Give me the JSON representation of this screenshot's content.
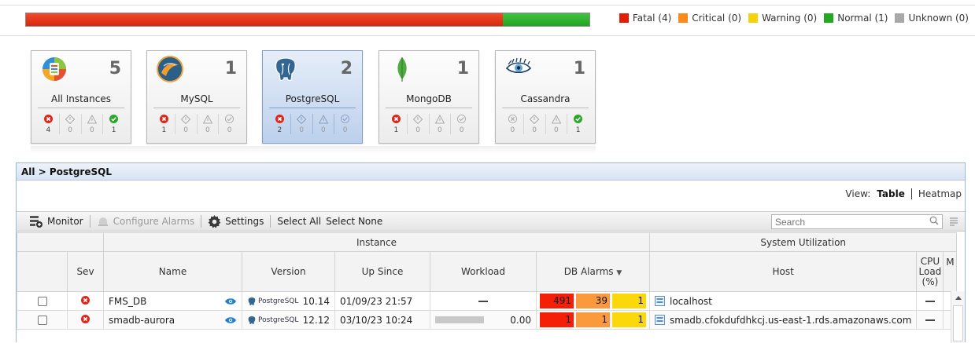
{
  "legend": [
    {
      "label": "Fatal (4)",
      "color": "#e41e04"
    },
    {
      "label": "Critical (0)",
      "color": "#fb8a1b"
    },
    {
      "label": "Warning (0)",
      "color": "#f6d20a"
    },
    {
      "label": "Normal (1)",
      "color": "#22a922"
    },
    {
      "label": "Unknown (0)",
      "color": "#a8a8a8"
    }
  ],
  "status_bar": {
    "fatal_fraction": 0.8,
    "normal_fraction": 0.2
  },
  "cards": [
    {
      "name": "All Instances",
      "count": "5",
      "icon": "all-instances-icon",
      "stats": [
        "4",
        "0",
        "0",
        "1"
      ]
    },
    {
      "name": "MySQL",
      "count": "1",
      "icon": "mysql-icon",
      "stats": [
        "1",
        "0",
        "0",
        "0"
      ]
    },
    {
      "name": "PostgreSQL",
      "count": "2",
      "icon": "postgresql-icon",
      "stats": [
        "2",
        "0",
        "0",
        "0"
      ],
      "selected": true
    },
    {
      "name": "MongoDB",
      "count": "1",
      "icon": "mongodb-leaf-icon",
      "stats": [
        "1",
        "0",
        "0",
        "0"
      ]
    },
    {
      "name": "Cassandra",
      "count": "1",
      "icon": "cassandra-eye-icon",
      "stats": [
        "0",
        "0",
        "0",
        "1"
      ]
    }
  ],
  "breadcrumb": "All > PostgreSQL",
  "view": {
    "label": "View:",
    "table": "Table",
    "heatmap": "Heatmap"
  },
  "toolbar": {
    "monitor": "Monitor",
    "configure_alarms": "Configure Alarms",
    "settings": "Settings",
    "select_all": "Select All",
    "select_none": "Select None",
    "search_placeholder": "Search"
  },
  "table": {
    "group_instance": "Instance",
    "group_system": "System Utilization",
    "columns": {
      "sev": "Sev",
      "name": "Name",
      "version": "Version",
      "up_since": "Up Since",
      "workload": "Workload",
      "db_alarms": "DB Alarms",
      "host": "Host",
      "cpu": "CPU Load (%)",
      "mem": "M"
    },
    "rows": [
      {
        "name": "FMS_DB",
        "db_type": "PostgreSQL",
        "version": "10.14",
        "up_since": "01/09/23 21:57",
        "workload": "",
        "alarms": [
          "491",
          "39",
          "1"
        ],
        "host": "localhost"
      },
      {
        "name": "smadb-aurora",
        "db_type": "PostgreSQL",
        "version": "12.12",
        "up_since": "03/10/23 10:24",
        "workload": "0.00",
        "alarms": [
          "1",
          "1",
          "1"
        ],
        "host": "smadb.cfokdufdhkcj.us-east-1.rds.amazonaws.com"
      }
    ]
  }
}
